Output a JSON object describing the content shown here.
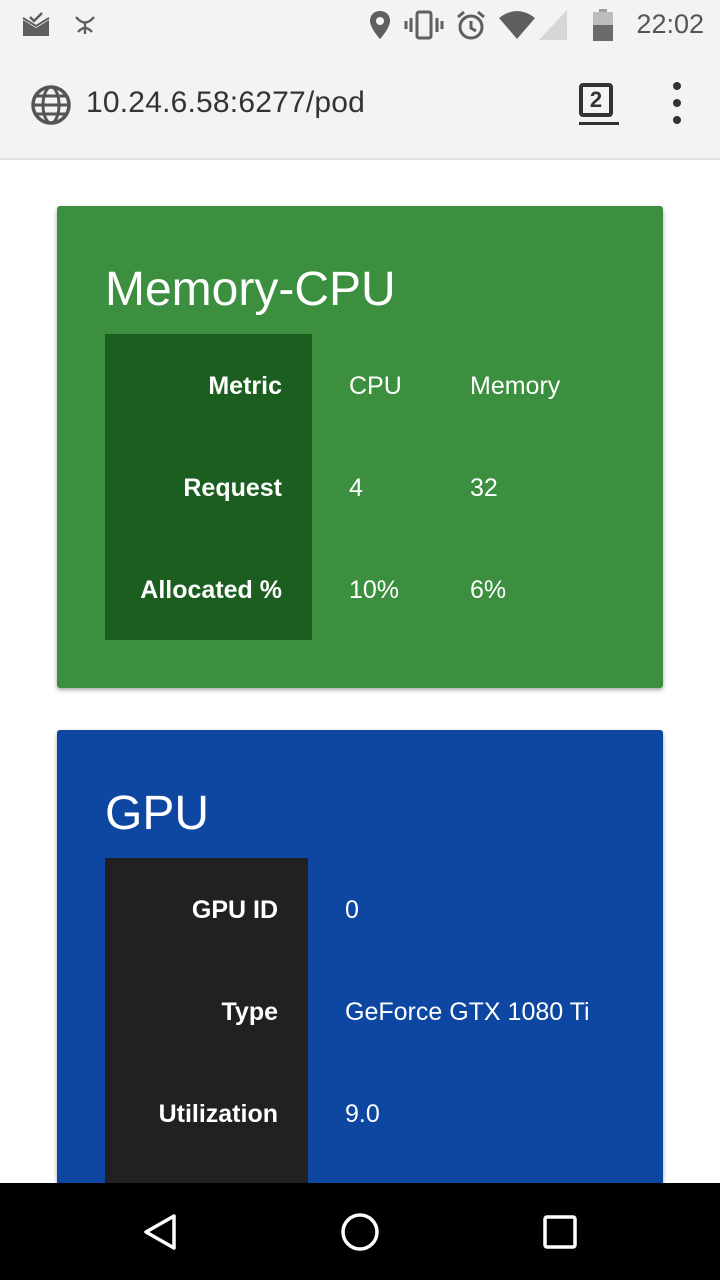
{
  "status_bar": {
    "time": "22:02",
    "left_icons": [
      "mail-check-icon",
      "app-notification-icon"
    ],
    "right_icons": [
      "location-icon",
      "vibrate-icon",
      "alarm-icon",
      "wifi-icon",
      "signal-icon",
      "battery-icon"
    ]
  },
  "browser": {
    "url": "10.24.6.58:6277/pod",
    "tab_count": "2",
    "url_icon": "globe-icon",
    "menu_icon": "more-vert-icon"
  },
  "memory_cpu": {
    "title": "Memory-CPU",
    "color": "#3b8f3e",
    "header_col_color": "#1b5e20",
    "rows": [
      {
        "header": "Metric",
        "c1": "CPU",
        "c2": "Memory"
      },
      {
        "header": "Request",
        "c1": "4",
        "c2": "32"
      },
      {
        "header": "Allocated %",
        "c1": "10%",
        "c2": "6%"
      }
    ]
  },
  "gpu": {
    "title": "GPU",
    "color": "#0d47a1",
    "header_col_color": "#212121",
    "rows": [
      {
        "header": "GPU ID",
        "value": "0"
      },
      {
        "header": "Type",
        "value": "GeForce GTX 1080 Ti"
      },
      {
        "header": "Utilization",
        "value": "9.0"
      }
    ]
  },
  "nav_bar": {
    "icons": [
      "back-icon",
      "home-icon",
      "recents-icon"
    ]
  }
}
